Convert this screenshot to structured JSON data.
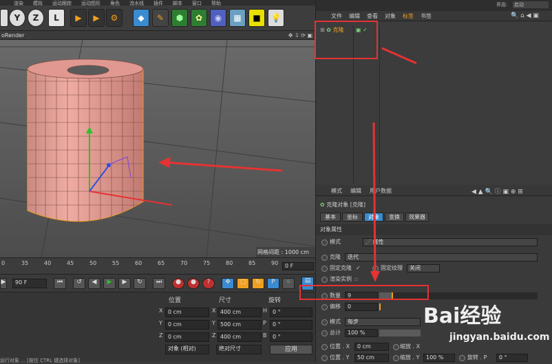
{
  "menu": [
    "渲染",
    "模拟",
    "运动跟踪",
    "运动图形",
    "角色",
    "流水线",
    "插件",
    "脚本",
    "窗口",
    "帮助"
  ],
  "layout_label": "界面:",
  "layout_value": "启动",
  "toolbar": {
    "y_axis": "Y",
    "z_axis": "Z"
  },
  "viewport": {
    "label": "oRender",
    "grid_info": "网格间距 : 1000 cm"
  },
  "timeline": {
    "ticks": [
      "0",
      "35",
      "40",
      "45",
      "50",
      "55",
      "60",
      "65",
      "70",
      "75",
      "80",
      "85",
      "90"
    ],
    "frame_field": "0 F"
  },
  "transport": {
    "end_frame": "90 F"
  },
  "coords": {
    "headers": {
      "position": "位置",
      "size": "尺寸",
      "rotation": "旋转"
    },
    "rows": [
      {
        "axis": "X",
        "pos": "0 cm",
        "size_axis": "X",
        "size": "400 cm",
        "rot_axis": "H",
        "rot": "0 °"
      },
      {
        "axis": "Y",
        "pos": "0 cm",
        "size_axis": "Y",
        "size": "500 cm",
        "rot_axis": "P",
        "rot": "0 °"
      },
      {
        "axis": "Z",
        "pos": "0 cm",
        "size_axis": "Z",
        "size": "400 cm",
        "rot_axis": "B",
        "rot": "0 °"
      }
    ],
    "mode1": "对象 (相对)",
    "mode2": "绝对尺寸",
    "apply": "应用"
  },
  "object_manager": {
    "menu": [
      "文件",
      "编辑",
      "查看",
      "对象",
      "标签",
      "书签"
    ],
    "object_name": "克隆"
  },
  "attributes": {
    "menu": [
      "模式",
      "编辑",
      "用户数据"
    ],
    "title": "克隆对象 [克隆]",
    "tabs": [
      "基本",
      "坐标",
      "对象",
      "变换",
      "效果器"
    ],
    "section": "对象属性",
    "mode_label": "模式",
    "mode_value": "线性",
    "clone_label": "克隆",
    "clone_value": "迭代",
    "fix_clone": "固定克隆",
    "fix_texture": "固定纹理",
    "fix_texture_value": "关闭",
    "render_instance": "渲染实例",
    "count_label": "数量",
    "count_value": "9",
    "offset_label": "偏移",
    "offset_value": "0",
    "mode2_label": "模式",
    "mode2_value": "每步",
    "total_label": "总计",
    "total_value": "100 %",
    "pos_label": "位置 . X",
    "pos_x": "0 cm",
    "scale_label": "缩放 . X",
    "pos_y_label": "位置 . Y",
    "pos_y": "50 cm",
    "scale_y_label": "缩放 . Y",
    "scale_y": "100 %",
    "rot_p_label": "旋转 . P",
    "rot_p": "0 °"
  },
  "status": "运行对象 ... [按住 CTRL 键选择对象]",
  "watermark": {
    "brand": "Bai经验",
    "url": "jingyan.baidu.com"
  },
  "colors": {
    "accent": "#f0a020",
    "cylinder": "#e8a098",
    "red_annotation": "#e63232"
  }
}
